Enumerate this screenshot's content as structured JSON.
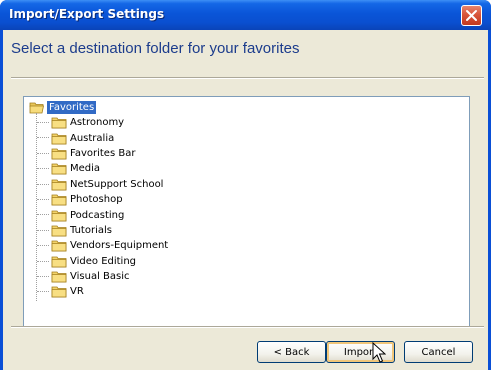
{
  "window": {
    "title": "Import/Export Settings"
  },
  "header": {
    "text": "Select a destination folder for your favorites"
  },
  "tree": {
    "root_label": "Favorites",
    "items": [
      {
        "label": "Astronomy"
      },
      {
        "label": "Australia"
      },
      {
        "label": "Favorites Bar"
      },
      {
        "label": "Media"
      },
      {
        "label": "NetSupport School"
      },
      {
        "label": "Photoshop"
      },
      {
        "label": "Podcasting"
      },
      {
        "label": "Tutorials"
      },
      {
        "label": "Vendors-Equipment"
      },
      {
        "label": "Video Editing"
      },
      {
        "label": "Visual Basic"
      },
      {
        "label": "VR"
      }
    ]
  },
  "buttons": {
    "back_label": "< Back",
    "import_label": "Import",
    "cancel_label": "Cancel"
  },
  "colors": {
    "titlebar": "#0a55d8",
    "dialog_bg": "#ece9d8",
    "selection": "#316ac5",
    "header_text": "#1c3c8c"
  }
}
